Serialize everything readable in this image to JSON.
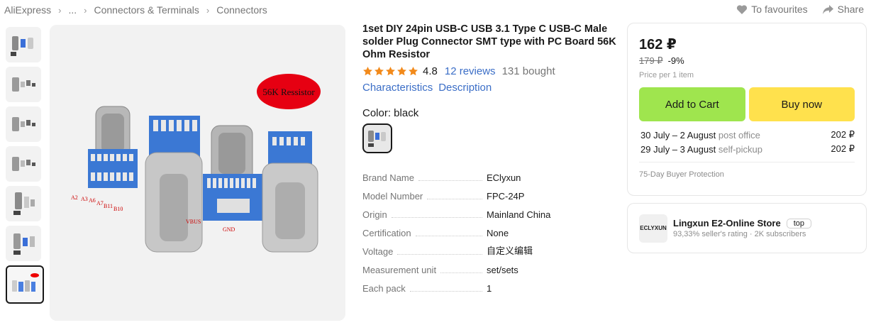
{
  "breadcrumb": [
    "AliExpress",
    "...",
    "Connectors & Terminals",
    "Connectors"
  ],
  "top_actions": {
    "favourites": "To favourites",
    "share": "Share"
  },
  "product": {
    "title": "1set DIY 24pin USB-C USB 3.1 Type C USB-C Male solder Plug Connector SMT type with PC Board 56K Ohm Resistor",
    "rating": "4.8",
    "reviews": "12 reviews",
    "bought": "131 bought",
    "characteristics_link": "Characteristics",
    "description_link": "Description",
    "color_label": "Color: black",
    "image_label": "56K Ressistor",
    "pin_labels": [
      "A2",
      "A3",
      "A6",
      "A7",
      "B11",
      "B10"
    ],
    "vbus_label": "VBUS",
    "gnd_label": "GND"
  },
  "specs": [
    {
      "key": "Brand Name",
      "value": "EClyxun"
    },
    {
      "key": "Model Number",
      "value": "FPC-24P"
    },
    {
      "key": "Origin",
      "value": "Mainland China"
    },
    {
      "key": "Certification",
      "value": "None"
    },
    {
      "key": "Voltage",
      "value": "自定义编辑"
    },
    {
      "key": "Measurement unit",
      "value": "set/sets"
    },
    {
      "key": "Each pack",
      "value": "1"
    }
  ],
  "buy_box": {
    "price": "162 ₽",
    "old_price": "179 ₽",
    "discount": "-9%",
    "per_item": "Price per 1 item",
    "add_to_cart": "Add to Cart",
    "buy_now": "Buy now",
    "delivery": [
      {
        "dates": "30 July – 2 August",
        "method": "post office",
        "price": "202 ₽"
      },
      {
        "dates": "29 July – 3 August",
        "method": "self-pickup",
        "price": "202 ₽"
      }
    ],
    "protection": "75-Day Buyer Protection"
  },
  "store": {
    "logo_text": "ECLYXUN",
    "name": "Lingxun E2-Online Store",
    "badge": "top",
    "rating": "93,33% seller's rating",
    "subscribers": "2K subscribers",
    "meta_separator": "·"
  },
  "colors": {
    "link": "#3b6ec7",
    "cart": "#9fe54e",
    "buy": "#ffe14d",
    "star": "#f28a1b"
  },
  "thumbnail_count": 7,
  "active_thumbnail": 7
}
